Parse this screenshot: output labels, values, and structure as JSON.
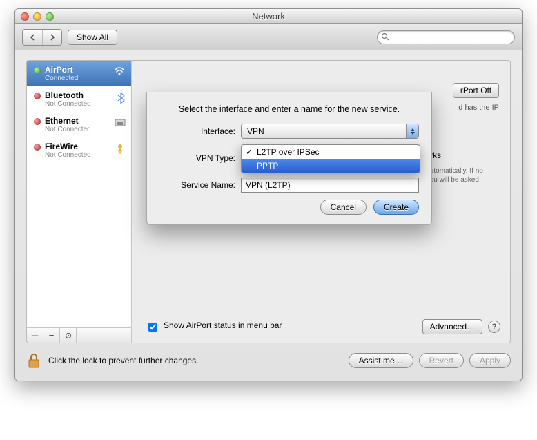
{
  "window": {
    "title": "Network"
  },
  "toolbar": {
    "show_all": "Show All",
    "search_placeholder": ""
  },
  "sidebar": {
    "services": [
      {
        "name": "AirPort",
        "status": "Connected",
        "dot": "green",
        "icon": "wifi-icon",
        "selected": true
      },
      {
        "name": "Bluetooth",
        "status": "Not Connected",
        "dot": "red",
        "icon": "bluetooth-icon",
        "selected": false
      },
      {
        "name": "Ethernet",
        "status": "Not Connected",
        "dot": "red",
        "icon": "ethernet-icon",
        "selected": false
      },
      {
        "name": "FireWire",
        "status": "Not Connected",
        "dot": "red",
        "icon": "firewire-icon",
        "selected": false
      }
    ]
  },
  "content": {
    "airport_off": "rPort Off",
    "has_ip": "d has the IP",
    "ask_join": "Ask to join new networks",
    "ask_help": "Known networks will be joined automatically. If no known networks are available, you will be asked before joining a new network.",
    "show_status": "Show AirPort status in menu bar",
    "advanced": "Advanced…",
    "help": "?"
  },
  "bottom": {
    "lock_text": "Click the lock to prevent further changes.",
    "assist": "Assist me…",
    "revert": "Revert",
    "apply": "Apply"
  },
  "sheet": {
    "message": "Select the interface and enter a name for the new service.",
    "labels": {
      "interface": "Interface:",
      "vpn_type": "VPN Type:",
      "service_name": "Service Name:"
    },
    "interface_value": "VPN",
    "vpn_type_options": [
      "L2TP over IPSec",
      "PPTP"
    ],
    "vpn_type_selected_index": 0,
    "vpn_type_highlight_index": 1,
    "service_name_value": "VPN (L2TP)",
    "cancel": "Cancel",
    "create": "Create"
  }
}
